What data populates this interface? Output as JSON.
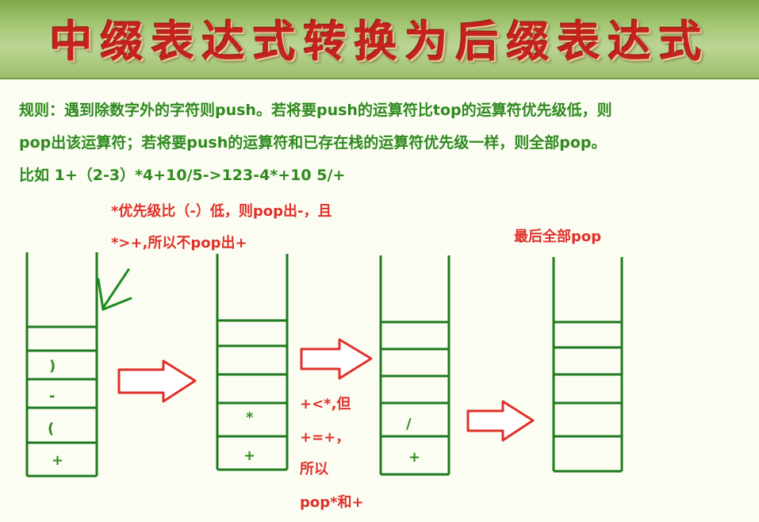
{
  "banner": {
    "title": "中缀表达式转换为后缀表达式"
  },
  "rules": [
    "规则：遇到除数字外的字符则push。若将要push的运算符比top的运算符优先级低，则",
    "pop出该运算符；若将要push的运算符和已存在栈的运算符优先级一样，则全部pop。",
    "比如 1+（2-3）*4+10/5->123-4*+10 5/+"
  ],
  "notes": {
    "first_line1": "*优先级比（-）低，则pop出-，且",
    "first_line2": "*>+,所以不pop出+",
    "second_line1": "+<*,但",
    "second_line2": "+=+，",
    "second_line3": "所以",
    "second_line4": "pop*和+",
    "final": "最后全部pop"
  },
  "stacks": [
    {
      "cells": [
        "",
        ")",
        "-",
        "(",
        "+"
      ]
    },
    {
      "cells": [
        "",
        "",
        "",
        "*",
        "+"
      ]
    },
    {
      "cells": [
        "",
        "",
        "",
        "/",
        "+"
      ]
    },
    {
      "cells": [
        "",
        "",
        "",
        "",
        ""
      ]
    }
  ],
  "colors": {
    "stack_line": "#1f7a1f",
    "arrow_outline": "#e0302a",
    "title_red": "#c4231c",
    "rule_green": "#2f8a1f",
    "note_red": "#e0302a"
  },
  "icons": [
    "down-left-arrow-icon",
    "right-arrow-icon"
  ]
}
